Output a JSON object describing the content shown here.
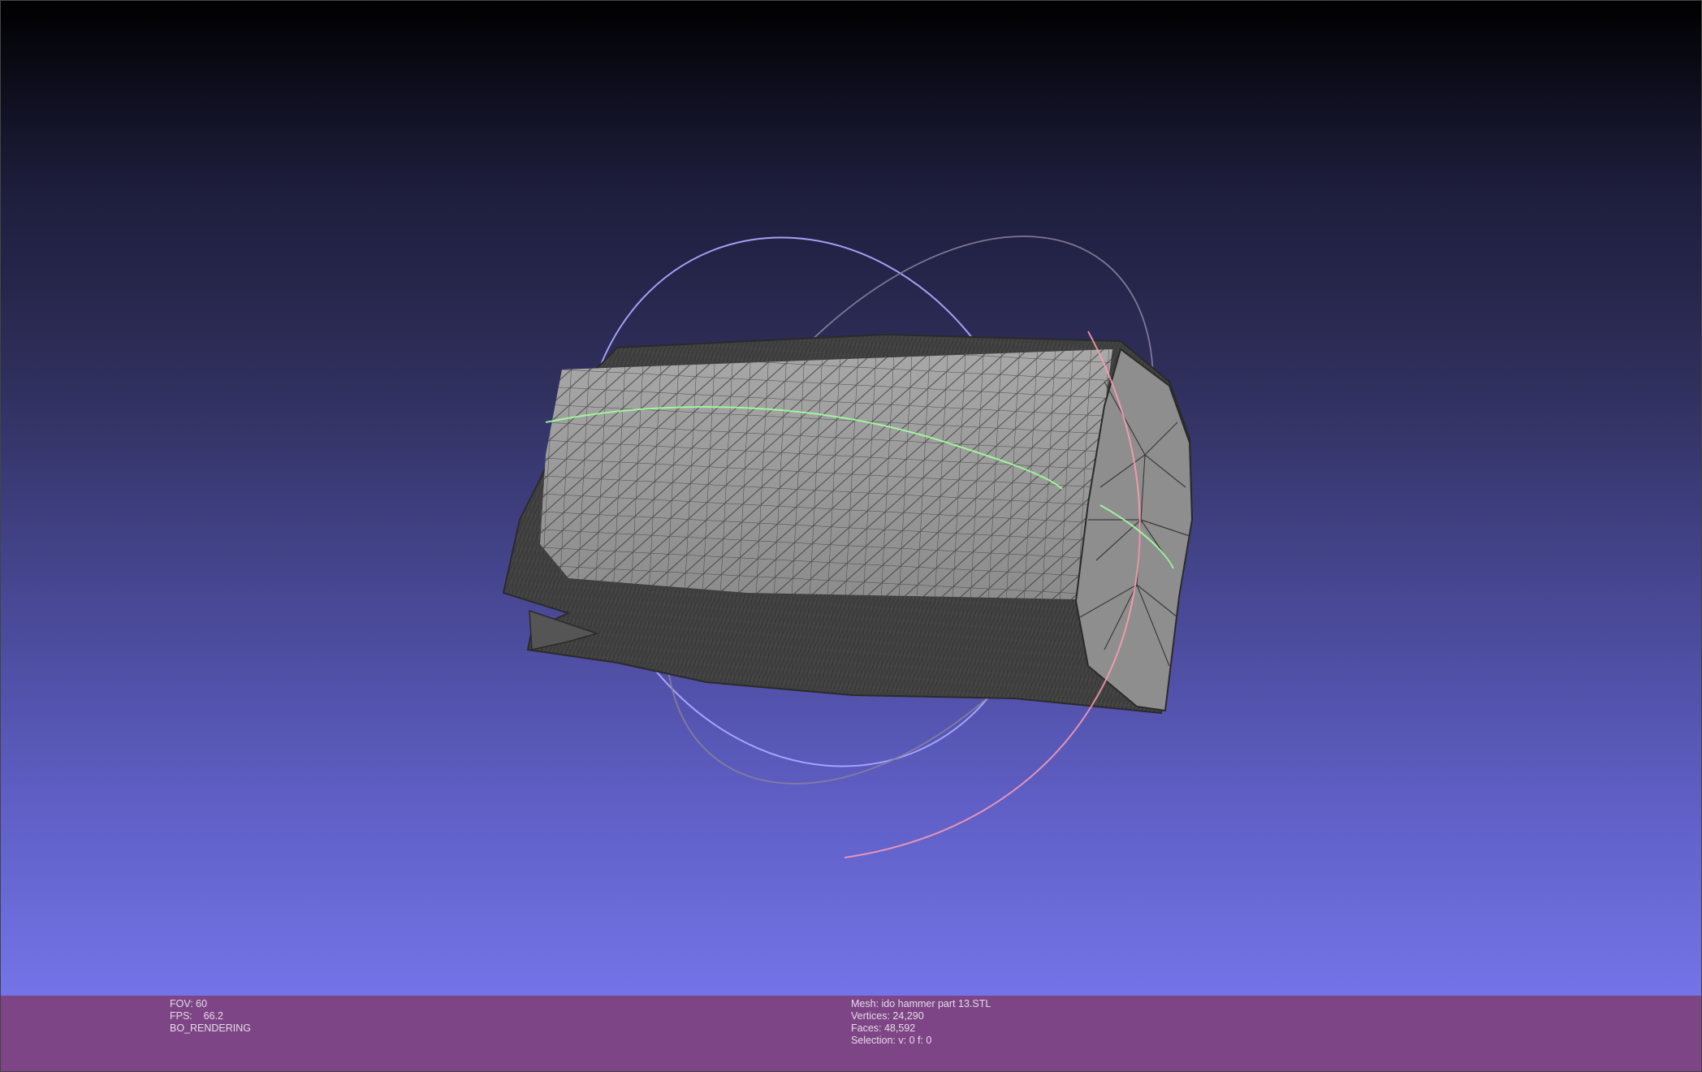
{
  "viewport": {
    "background_top": "#000000",
    "background_bottom": "#7474e8",
    "mesh_color": "#9a9a9a",
    "wire_color": "#3c3c3c",
    "trackball_colors": {
      "x_ring": "#ff9db0",
      "y_ring": "#a0ff9d",
      "z_ring": "#a9a9ff"
    }
  },
  "info_left": {
    "fov": "FOV: 60",
    "fps": "FPS:    66.2",
    "render_mode": "BO_RENDERING"
  },
  "info_right": {
    "mesh": "Mesh: ido hammer part 13.STL",
    "vertices": "Vertices: 24,290",
    "faces": "Faces: 48,592",
    "selection": "Selection: v: 0 f: 0"
  },
  "infobar_color": "#7d4585"
}
